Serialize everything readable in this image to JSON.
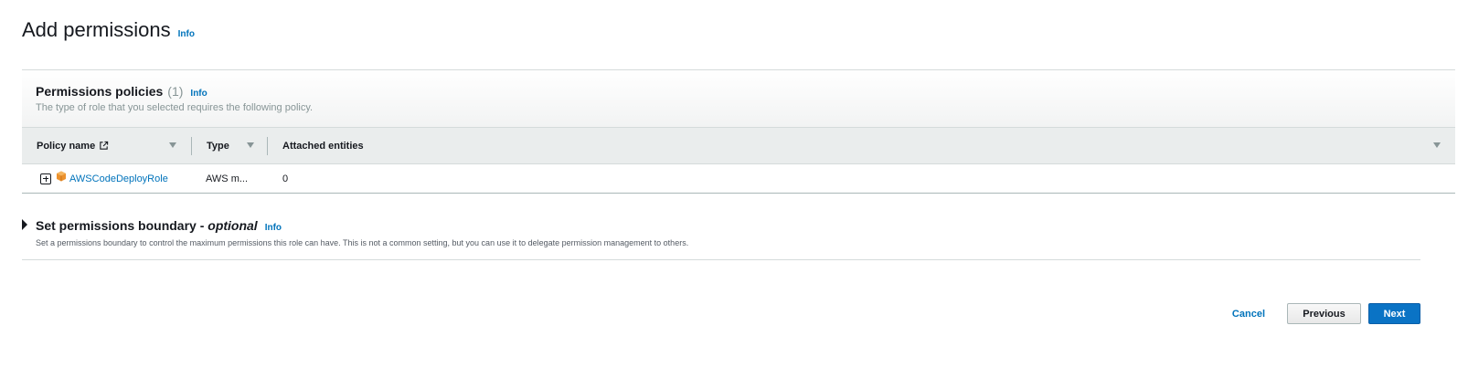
{
  "page": {
    "title": "Add permissions",
    "info": "Info"
  },
  "policies": {
    "title": "Permissions policies",
    "count": "(1)",
    "info": "Info",
    "description": "The type of role that you selected requires the following policy.",
    "columns": {
      "policy_name": "Policy name",
      "type": "Type",
      "attached": "Attached entities"
    },
    "rows": [
      {
        "name": "AWSCodeDeployRole",
        "type": "AWS m...",
        "attached": "0"
      }
    ]
  },
  "boundary": {
    "title": "Set permissions boundary - ",
    "title_optional": "optional",
    "info": "Info",
    "description": "Set a permissions boundary to control the maximum permissions this role can have. This is not a common setting, but you can use it to delegate permission management to others."
  },
  "actions": {
    "cancel": "Cancel",
    "previous": "Previous",
    "next": "Next"
  },
  "colors": {
    "link": "#0073bb",
    "primary_button": "#0a73c5",
    "aws_icon": "#ec912d"
  }
}
